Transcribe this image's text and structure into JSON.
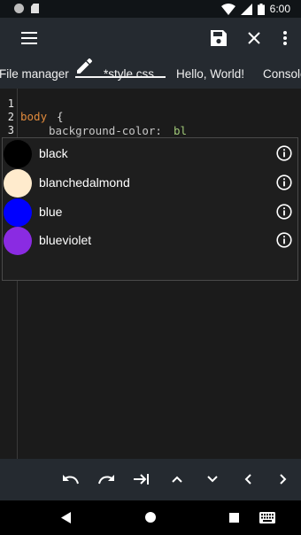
{
  "status_bar": {
    "time": "6:00"
  },
  "tabs": [
    "File manager",
    "*style.css",
    "Hello, World!",
    "Console"
  ],
  "editor": {
    "line_numbers": [
      "1",
      "2",
      "3"
    ],
    "line2_selector": "body",
    "line2_brace": "{",
    "line3_property": "background-color:",
    "line3_value": "bl"
  },
  "autocomplete": {
    "items": [
      {
        "label": "black",
        "color": "#000000"
      },
      {
        "label": "blanchedalmond",
        "color": "#ffebcd"
      },
      {
        "label": "blue",
        "color": "#0000ff"
      },
      {
        "label": "blueviolet",
        "color": "#8a2be2"
      }
    ]
  },
  "colors": {
    "toolbar_bg": "#252a30",
    "editor_bg": "#1b1b1b",
    "selector": "#e08a3c",
    "property": "#c8c8c8",
    "value": "#a0c878"
  }
}
